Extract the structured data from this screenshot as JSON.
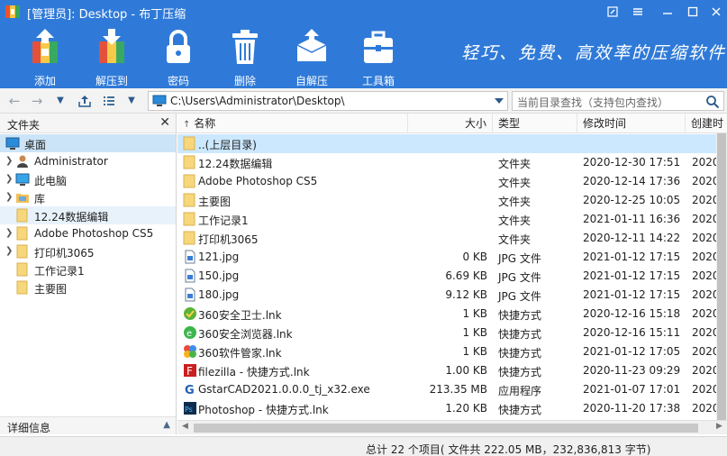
{
  "window": {
    "title": "[管理员]: Desktop - 布丁压缩"
  },
  "toolbar": {
    "items": [
      {
        "label": "添加",
        "icon": "add-archive-icon"
      },
      {
        "label": "解压到",
        "icon": "extract-icon"
      },
      {
        "label": "密码",
        "icon": "lock-icon"
      },
      {
        "label": "删除",
        "icon": "trash-icon"
      },
      {
        "label": "自解压",
        "icon": "self-extract-icon"
      },
      {
        "label": "工具箱",
        "icon": "toolbox-icon"
      }
    ],
    "slogan": "轻巧、免费、高效率的压缩软件"
  },
  "address": {
    "path": "C:\\Users\\Administrator\\Desktop\\",
    "search_placeholder": "当前目录查找（支持包内查找）"
  },
  "sidebar": {
    "header": "文件夹",
    "footer": "详细信息",
    "items": [
      {
        "label": "桌面",
        "icon": "desktop-icon"
      },
      {
        "label": "Administrator",
        "icon": "user-icon"
      },
      {
        "label": "此电脑",
        "icon": "computer-icon"
      },
      {
        "label": "库",
        "icon": "library-icon"
      },
      {
        "label": "12.24数据编辑",
        "icon": "folder-icon"
      },
      {
        "label": "Adobe Photoshop CS5",
        "icon": "folder-icon"
      },
      {
        "label": "打印机3065",
        "icon": "folder-icon"
      },
      {
        "label": "工作记录1",
        "icon": "folder-icon"
      },
      {
        "label": "主要图",
        "icon": "folder-icon"
      }
    ]
  },
  "columns": {
    "name": "名称",
    "size": "大小",
    "type": "类型",
    "modified": "修改时间",
    "created": "创建时"
  },
  "files": [
    {
      "name": "..(上层目录)",
      "size": "",
      "type": "",
      "modified": "",
      "created": "",
      "icon": "folder-icon"
    },
    {
      "name": "12.24数据编辑",
      "size": "",
      "type": "文件夹",
      "modified": "2020-12-30 17:51",
      "created": "2020",
      "icon": "folder-icon"
    },
    {
      "name": "Adobe Photoshop CS5",
      "size": "",
      "type": "文件夹",
      "modified": "2020-12-14 17:36",
      "created": "2020",
      "icon": "folder-icon"
    },
    {
      "name": "主要图",
      "size": "",
      "type": "文件夹",
      "modified": "2020-12-25 10:05",
      "created": "2020",
      "icon": "folder-icon"
    },
    {
      "name": "工作记录1",
      "size": "",
      "type": "文件夹",
      "modified": "2021-01-11 16:36",
      "created": "2020",
      "icon": "folder-icon"
    },
    {
      "name": "打印机3065",
      "size": "",
      "type": "文件夹",
      "modified": "2020-12-11 14:22",
      "created": "2020",
      "icon": "folder-icon"
    },
    {
      "name": "121.jpg",
      "size": "0 KB",
      "type": "JPG 文件",
      "modified": "2021-01-12 17:15",
      "created": "2020",
      "icon": "image-file-icon"
    },
    {
      "name": "150.jpg",
      "size": "6.69 KB",
      "type": "JPG 文件",
      "modified": "2021-01-12 17:15",
      "created": "2020",
      "icon": "image-file-icon"
    },
    {
      "name": "180.jpg",
      "size": "9.12 KB",
      "type": "JPG 文件",
      "modified": "2021-01-12 17:15",
      "created": "2020",
      "icon": "image-file-icon"
    },
    {
      "name": "360安全卫士.lnk",
      "size": "1 KB",
      "type": "快捷方式",
      "modified": "2020-12-16 15:18",
      "created": "2020",
      "icon": "security-guard-icon"
    },
    {
      "name": "360安全浏览器.lnk",
      "size": "1 KB",
      "type": "快捷方式",
      "modified": "2020-12-16 15:11",
      "created": "2020",
      "icon": "browser-icon"
    },
    {
      "name": "360软件管家.lnk",
      "size": "1 KB",
      "type": "快捷方式",
      "modified": "2021-01-12 17:05",
      "created": "2020",
      "icon": "software-manager-icon"
    },
    {
      "name": "filezilla - 快捷方式.lnk",
      "size": "1.00 KB",
      "type": "快捷方式",
      "modified": "2020-11-23 09:29",
      "created": "2020",
      "icon": "filezilla-icon"
    },
    {
      "name": "GstarCAD2021.0.0.0_tj_x32.exe",
      "size": "213.35 MB",
      "type": "应用程序",
      "modified": "2021-01-07 17:01",
      "created": "2020",
      "icon": "gstarcad-icon"
    },
    {
      "name": "Photoshop - 快捷方式.lnk",
      "size": "1.20 KB",
      "type": "快捷方式",
      "modified": "2020-11-20 17:38",
      "created": "2020",
      "icon": "photoshop-icon"
    }
  ],
  "status": {
    "summary": "总计 22 个项目( 文件共 222.05 MB，232,836,813 字节)"
  },
  "colors": {
    "toolbar_blue": "#2f7ad8",
    "selection": "#cce8ff",
    "folder": "#f5c95c"
  }
}
